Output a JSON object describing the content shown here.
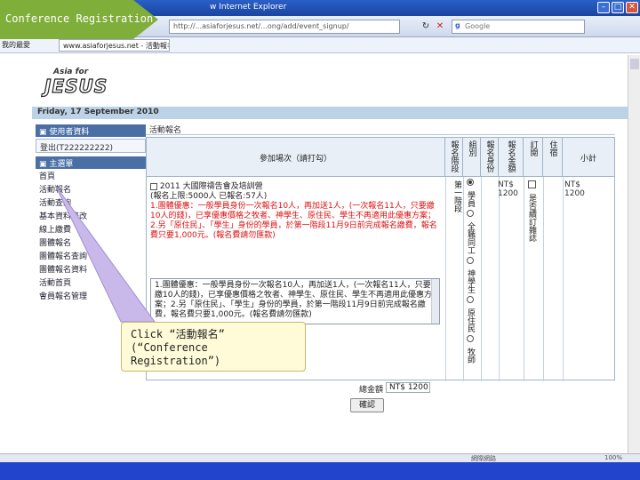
{
  "window": {
    "title": "w Internet Explorer",
    "minimize": "–",
    "maximize": "□",
    "close": "✕"
  },
  "address": {
    "url": "http://...asiaforjesus.net/...ong/add/event_signup/",
    "back": "◀",
    "refresh": "↻",
    "stop": "✕",
    "search_placeholder": "Google",
    "search_logo": "g"
  },
  "favorites": {
    "label": "我的最愛",
    "tab_label": "www.asiaforjesus.net - 活動報名"
  },
  "callout_top": {
    "text": "Conference Registration",
    "color": "#7fae3a"
  },
  "logo": {
    "asia": "Asia for",
    "jesus": "JESUS"
  },
  "datebar": {
    "text": "Friday, 17 September 2010"
  },
  "sidebar": {
    "section1": "使用者資料",
    "login": "登出(T222222222)",
    "section2": "主選單",
    "items": [
      {
        "label": "首頁"
      },
      {
        "label": "活動報名"
      },
      {
        "label": "活動查詢"
      },
      {
        "label": "基本資料修改"
      },
      {
        "label": "線上繳費"
      },
      {
        "label": "團體報名"
      },
      {
        "label": "團體報名查詢"
      },
      {
        "label": "團體報名資料"
      },
      {
        "label": "活動首頁"
      },
      {
        "label": "會員報名管理"
      }
    ]
  },
  "main": {
    "title": "活動報名",
    "headers": {
      "event": "參加場次（請打勾）",
      "stage": "報名階段",
      "group": "組別",
      "identity": "報名身份",
      "fee": "報名金額",
      "subscribe": "訂閱",
      "lodging": "住宿",
      "subtotal": "小計"
    },
    "stage_value": "第一階段",
    "event_name": "2011 大國際禱告會及培訓營",
    "event_limit": "(報名上限:5000人 已報名:57人)",
    "event_notes": "1.團體優惠：一般學員身份一次報名10人，再加送1人，(一次報名11人，只要繳10人的錢)，已享優惠價格之牧者、神學生、原住民、學生不再適用此優惠方案；2.另「原住民」、「學生」身份的學員，於第一階段11月9日前完成報名繳費，報名費只要1,000元。(報名費請勿匯款)",
    "textarea_text": "1.團體優惠：一般學員身份一次報名10人，再加送1人，(一次報名11人，只要繳10人的錢)，已享優惠價格之牧者、神學生、原住民、學生不再適用此優惠方案；2.另「原住民」、「學生」身份的學員，於第一階段11月9日前完成報名繳費，報名費只要1,000元。(報名費請勿匯款)",
    "identities": [
      {
        "label": "學員",
        "selected": true
      },
      {
        "label": "全職同工",
        "selected": false
      },
      {
        "label": "神學生",
        "selected": false
      },
      {
        "label": "原住民",
        "selected": false
      },
      {
        "label": "牧師",
        "selected": false
      }
    ],
    "fee_value": "NT$ 1200",
    "renew_label": "是否續訂雜誌",
    "subtotal_value": "NT$ 1200",
    "total_label": "總金額",
    "total_value": "NT$ 1200",
    "confirm_button": "確認"
  },
  "callout_bottom": {
    "line1": "Click “活動報名”",
    "line2": "(“Conference",
    "line3": "Registration”)"
  },
  "statusbar": {
    "text": "網際網路",
    "zoom": "100%"
  }
}
